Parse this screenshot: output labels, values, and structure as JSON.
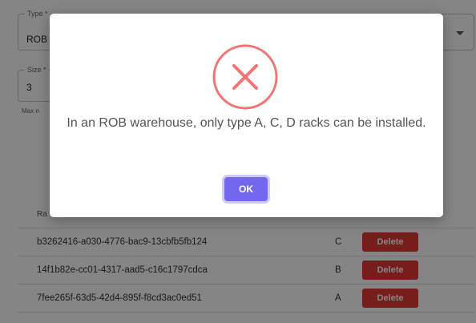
{
  "form": {
    "type_label": "Type *",
    "type_value": "ROB",
    "size_label": "Size *",
    "size_value": "3",
    "helper_text": "Max n"
  },
  "table": {
    "header_fragment": "Ra",
    "delete_label": "Delete",
    "rows": [
      {
        "id": "b3262416-a030-4776-bac9-13cbfb5fb124",
        "type": "C"
      },
      {
        "id": "14f1b82e-cc01-4317-aad5-c16c1797cdca",
        "type": "B"
      },
      {
        "id": "7fee265f-63d5-42d4-895f-f8cd3ac0ed51",
        "type": "A"
      }
    ]
  },
  "dialog": {
    "icon": "error-x-icon",
    "message": "In an ROB warehouse, only type A, C, D racks can be installed.",
    "ok_label": "OK"
  },
  "colors": {
    "error": "#f27474",
    "confirm": "#7367f0",
    "delete": "#e53935"
  }
}
